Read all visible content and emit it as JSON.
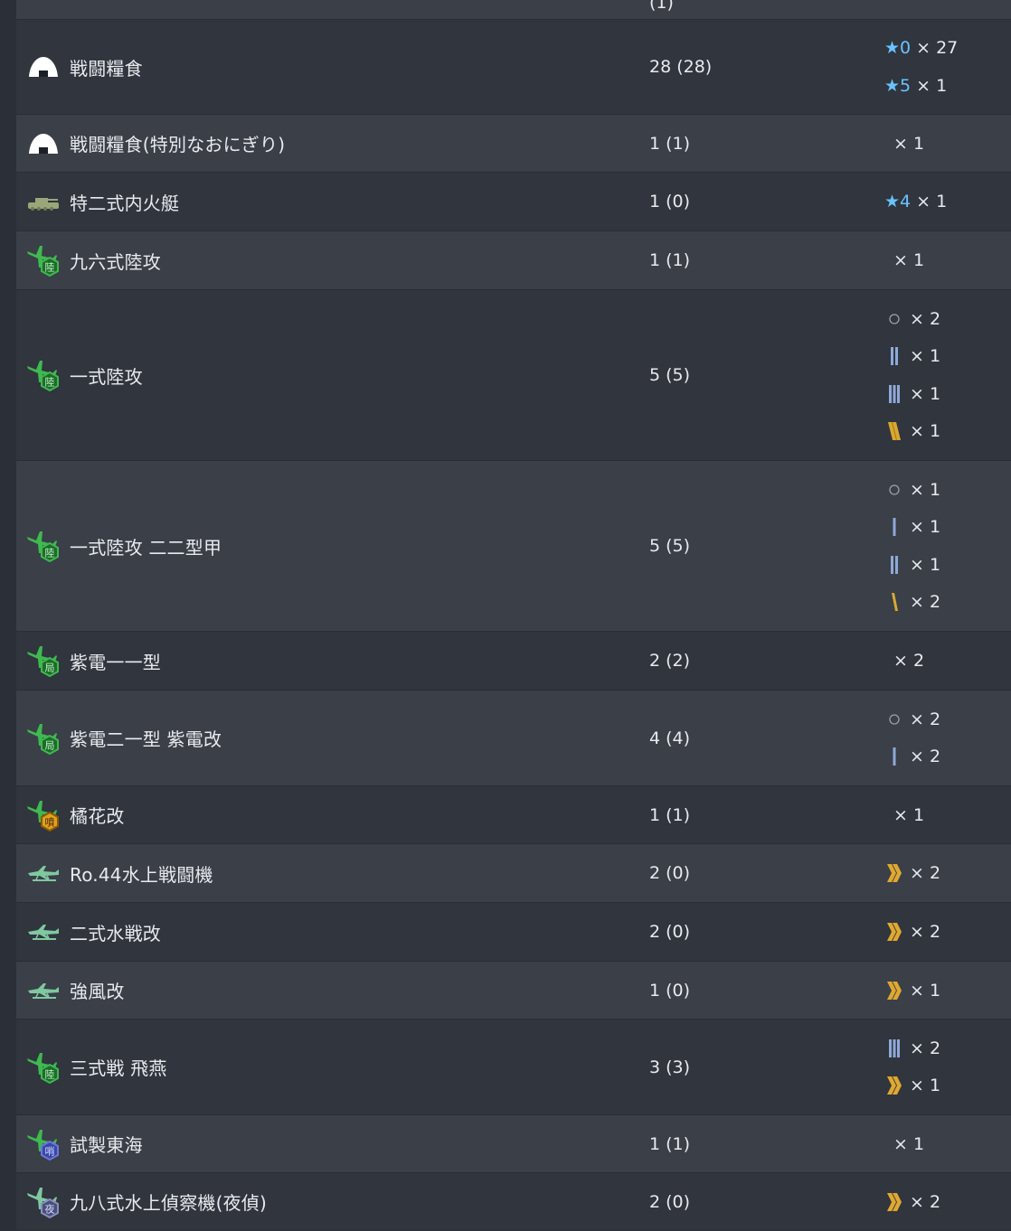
{
  "colors": {
    "bg": "#2b2f37",
    "row_even": "#30353e",
    "row_odd": "#3a3f48",
    "text": "#e8eaed",
    "star": "#6ac3ff",
    "skill_blue": "#8fa8d8",
    "skill_gold": "#d8a830",
    "plane_green": "#3fb950"
  },
  "partial_row": {
    "count": "(1)"
  },
  "rows": [
    {
      "icon": "ration-icon",
      "name": "戦闘糧食",
      "count": "28 (28)",
      "prof": [
        {
          "type": "star",
          "mark": "★0",
          "x": "× 27"
        },
        {
          "type": "star",
          "mark": "★5",
          "x": "× 1"
        }
      ]
    },
    {
      "icon": "ration-icon",
      "name": "戦闘糧食(特別なおにぎり)",
      "count": "1 (1)",
      "prof": [
        {
          "type": "none",
          "x": "× 1"
        }
      ]
    },
    {
      "icon": "landing-craft-icon",
      "name": "特二式内火艇",
      "count": "1 (0)",
      "prof": [
        {
          "type": "star",
          "mark": "★4",
          "x": "× 1"
        }
      ]
    },
    {
      "icon": "land-attacker-icon",
      "badge": "陸",
      "name": "九六式陸攻",
      "count": "1 (1)",
      "prof": [
        {
          "type": "none",
          "x": "× 1"
        }
      ]
    },
    {
      "icon": "land-attacker-icon",
      "badge": "陸",
      "name": "一式陸攻",
      "count": "5 (5)",
      "prof": [
        {
          "type": "circle",
          "x": "× 2"
        },
        {
          "type": "bar2",
          "x": "× 1"
        },
        {
          "type": "bar3",
          "x": "× 1"
        },
        {
          "type": "gold-slash2",
          "x": "× 1"
        }
      ]
    },
    {
      "icon": "land-attacker-icon",
      "badge": "陸",
      "name": "一式陸攻 二二型甲",
      "count": "5 (5)",
      "prof": [
        {
          "type": "circle",
          "x": "× 1"
        },
        {
          "type": "bar1",
          "x": "× 1"
        },
        {
          "type": "bar2",
          "x": "× 1"
        },
        {
          "type": "gold-slash1",
          "x": "× 2"
        }
      ]
    },
    {
      "icon": "interceptor-icon",
      "badge": "局",
      "name": "紫電一一型",
      "count": "2 (2)",
      "prof": [
        {
          "type": "none",
          "x": "× 2"
        }
      ]
    },
    {
      "icon": "interceptor-icon",
      "badge": "局",
      "name": "紫電二一型 紫電改",
      "count": "4 (4)",
      "prof": [
        {
          "type": "circle",
          "x": "× 2"
        },
        {
          "type": "bar1",
          "x": "× 2"
        }
      ]
    },
    {
      "icon": "jet-icon",
      "badge": "噴",
      "name": "橘花改",
      "count": "1 (1)",
      "prof": [
        {
          "type": "none",
          "x": "× 1"
        }
      ]
    },
    {
      "icon": "seaplane-fighter-icon",
      "name": "Ro.44水上戦闘機",
      "count": "2 (0)",
      "prof": [
        {
          "type": "chevron",
          "x": "× 2"
        }
      ]
    },
    {
      "icon": "seaplane-fighter-icon",
      "name": "二式水戦改",
      "count": "2 (0)",
      "prof": [
        {
          "type": "chevron",
          "x": "× 2"
        }
      ]
    },
    {
      "icon": "seaplane-fighter-icon",
      "name": "強風改",
      "count": "1 (0)",
      "prof": [
        {
          "type": "chevron",
          "x": "× 1"
        }
      ]
    },
    {
      "icon": "land-fighter-icon",
      "badge": "陸",
      "name": "三式戦 飛燕",
      "count": "3 (3)",
      "prof": [
        {
          "type": "bar3",
          "x": "× 2"
        },
        {
          "type": "chevron",
          "x": "× 1"
        }
      ]
    },
    {
      "icon": "patrol-icon",
      "badge": "哨",
      "name": "試製東海",
      "count": "1 (1)",
      "prof": [
        {
          "type": "none",
          "x": "× 1"
        }
      ]
    },
    {
      "icon": "night-recon-icon",
      "badge": "夜",
      "name": "九八式水上偵察機(夜偵)",
      "count": "2 (0)",
      "prof": [
        {
          "type": "chevron",
          "x": "× 2"
        }
      ]
    }
  ]
}
